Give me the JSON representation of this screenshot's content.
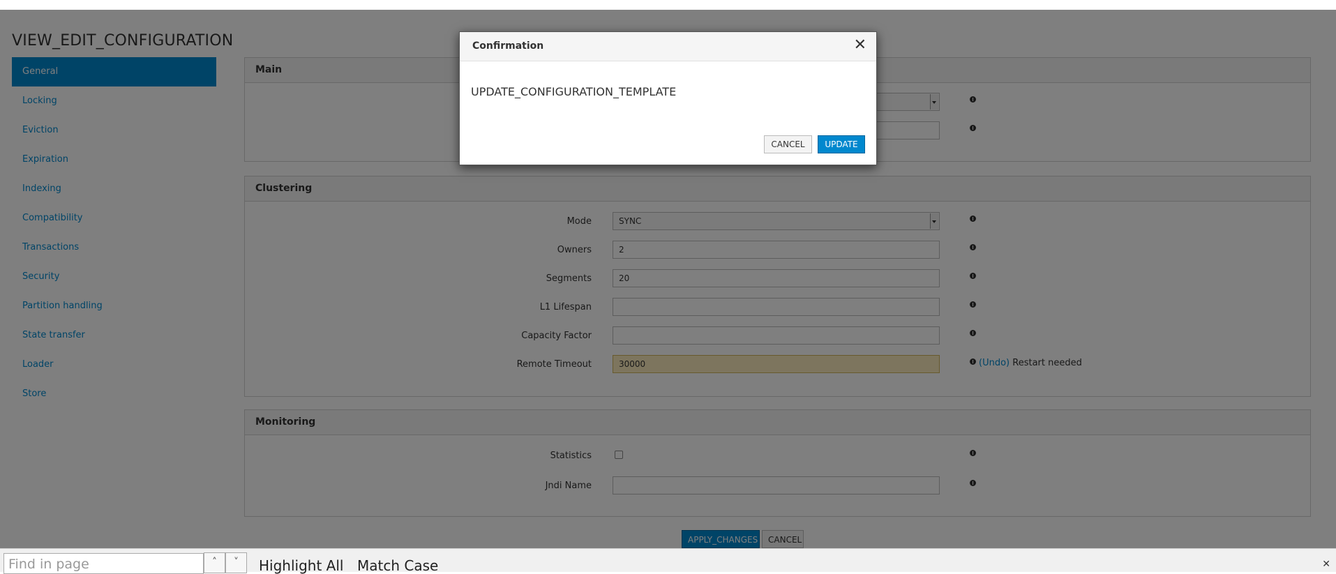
{
  "page": {
    "title": "VIEW_EDIT_CONFIGURATION"
  },
  "sidebar": {
    "items": [
      {
        "label": "General",
        "active": true
      },
      {
        "label": "Locking"
      },
      {
        "label": "Eviction"
      },
      {
        "label": "Expiration"
      },
      {
        "label": "Indexing"
      },
      {
        "label": "Compatibility"
      },
      {
        "label": "Transactions"
      },
      {
        "label": "Security"
      },
      {
        "label": "Partition handling"
      },
      {
        "label": "State transfer"
      },
      {
        "label": "Loader"
      },
      {
        "label": "Store"
      }
    ]
  },
  "main_panel": {
    "title": "Main"
  },
  "clustering": {
    "title": "Clustering",
    "mode": {
      "label": "Mode",
      "value": "SYNC"
    },
    "owners": {
      "label": "Owners",
      "value": "2"
    },
    "segments": {
      "label": "Segments",
      "value": "20"
    },
    "l1_lifespan": {
      "label": "L1 Lifespan",
      "value": ""
    },
    "capacity_factor": {
      "label": "Capacity Factor",
      "value": ""
    },
    "remote_timeout": {
      "label": "Remote Timeout",
      "value": "30000",
      "undo": "(Undo)",
      "note": "Restart needed"
    }
  },
  "monitoring": {
    "title": "Monitoring",
    "statistics": {
      "label": "Statistics",
      "checked": false
    },
    "jndi_name": {
      "label": "Jndi Name",
      "value": ""
    }
  },
  "actions": {
    "apply": "APPLY_CHANGES",
    "cancel": "CANCEL"
  },
  "modal": {
    "title": "Confirmation",
    "message": "UPDATE_CONFIGURATION_TEMPLATE",
    "cancel": "CANCEL",
    "update": "UPDATE"
  },
  "findbar": {
    "placeholder": "Find in page",
    "highlight_all": "Highlight All",
    "match_case": "Match Case"
  },
  "colors": {
    "accent": "#0088ce",
    "changed_field": "#fbeabc",
    "overlay": "rgba(0,0,0,0.5)"
  },
  "icons": {
    "info": "info-icon",
    "close": "close-icon",
    "up": "chevron-up-icon",
    "down": "chevron-down-icon"
  }
}
